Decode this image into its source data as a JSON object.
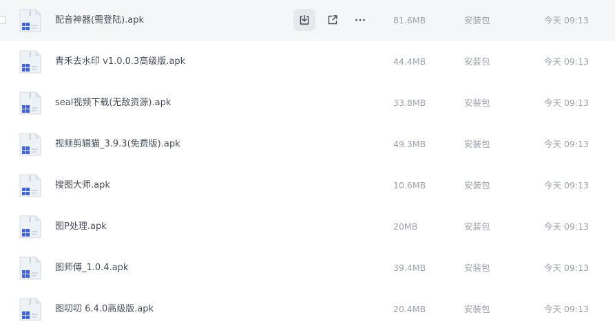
{
  "files": [
    {
      "name": "配音神器(需登陆).apk",
      "size": "81.6MB",
      "type": "安装包",
      "time": "今天 09:13"
    },
    {
      "name": "青禾去水印 v1.0.0.3高级版.apk",
      "size": "44.4MB",
      "type": "安装包",
      "time": "今天 09:13"
    },
    {
      "name": "seal视频下载(无敌资源).apk",
      "size": "33.8MB",
      "type": "安装包",
      "time": "今天 09:13"
    },
    {
      "name": "视频剪辑猫_3.9.3(免费版).apk",
      "size": "49.3MB",
      "type": "安装包",
      "time": "今天 09:13"
    },
    {
      "name": "搜图大师.apk",
      "size": "10.6MB",
      "type": "安装包",
      "time": "今天 09:13"
    },
    {
      "name": "图P处理.apk",
      "size": "20MB",
      "type": "安装包",
      "time": "今天 09:13"
    },
    {
      "name": "图师傅_1.0.4.apk",
      "size": "39.4MB",
      "type": "安装包",
      "time": "今天 09:13"
    },
    {
      "name": "图叨叨 6.4.0高级版.apk",
      "size": "20.4MB",
      "type": "安装包",
      "time": "今天 09:13"
    }
  ],
  "row_actions": {
    "download": "download-icon",
    "share": "share-icon",
    "more": "more-icon"
  },
  "colors": {
    "hover_bg": "#f5f6f8",
    "text": "#454d5a",
    "muted": "#9aa1ab",
    "icon_blue": "#4a6cf7"
  }
}
